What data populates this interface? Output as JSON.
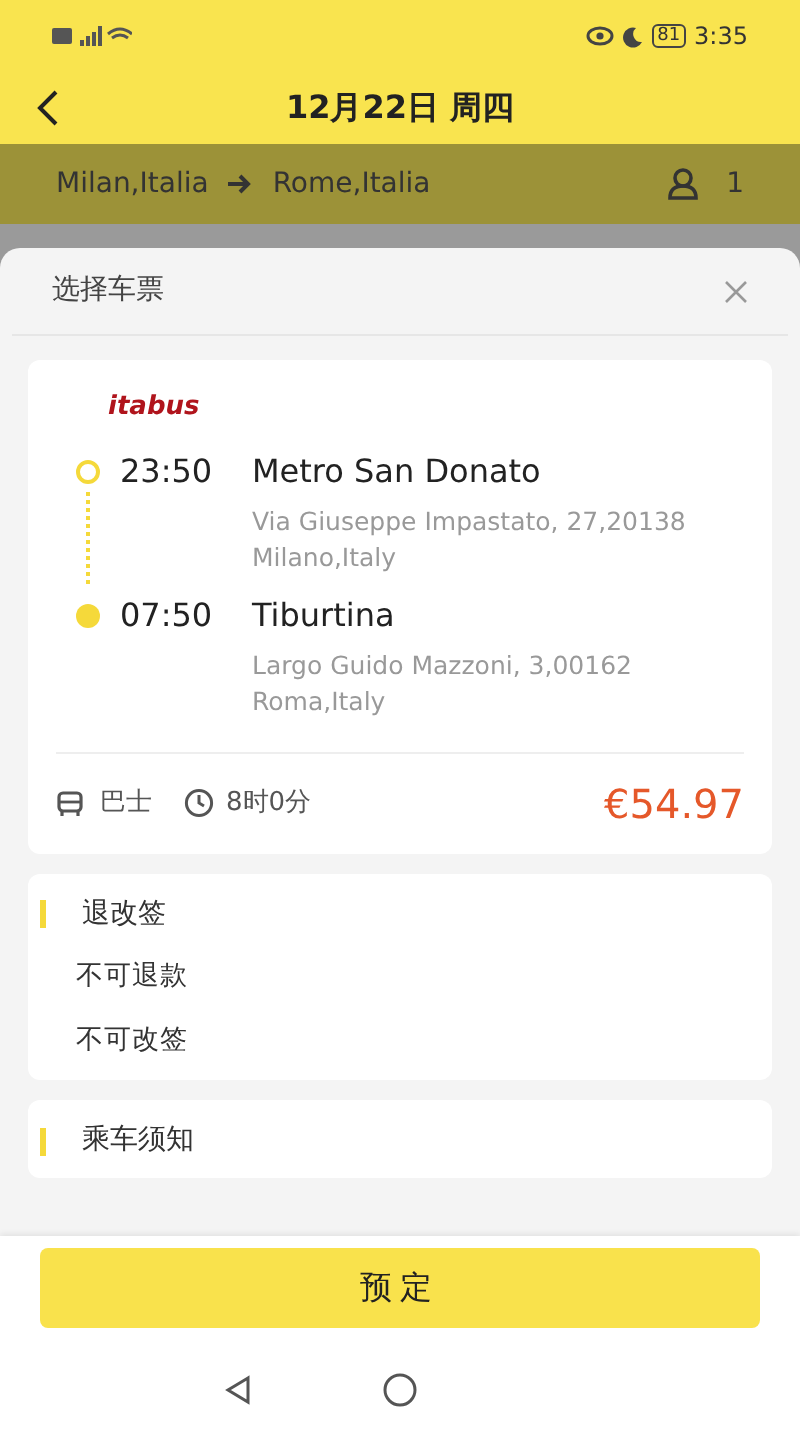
{
  "status_bar": {
    "battery": "81",
    "time": "3:35"
  },
  "header": {
    "title": "12月22日 周四"
  },
  "route": {
    "from": "Milan,Italia",
    "to": "Rome,Italia",
    "passengers": "1"
  },
  "sheet": {
    "title": "选择车票"
  },
  "ticket": {
    "operator": "itabus",
    "stops": [
      {
        "time": "23:50",
        "name": "Metro San Donato",
        "address": "Via Giuseppe Impastato, 27,20138 Milano,Italy",
        "kind": "origin"
      },
      {
        "time": "07:50",
        "name": "Tiburtina",
        "address": "Largo Guido Mazzoni, 3,00162 Roma,Italy",
        "kind": "destination"
      }
    ],
    "vehicle": "巴士",
    "duration": "8时0分",
    "price": "€54.97"
  },
  "sections": [
    {
      "title": "退改签",
      "lines": [
        "不可退款",
        "不可改签"
      ]
    },
    {
      "title": "乘车须知"
    }
  ],
  "book_button": "预定"
}
